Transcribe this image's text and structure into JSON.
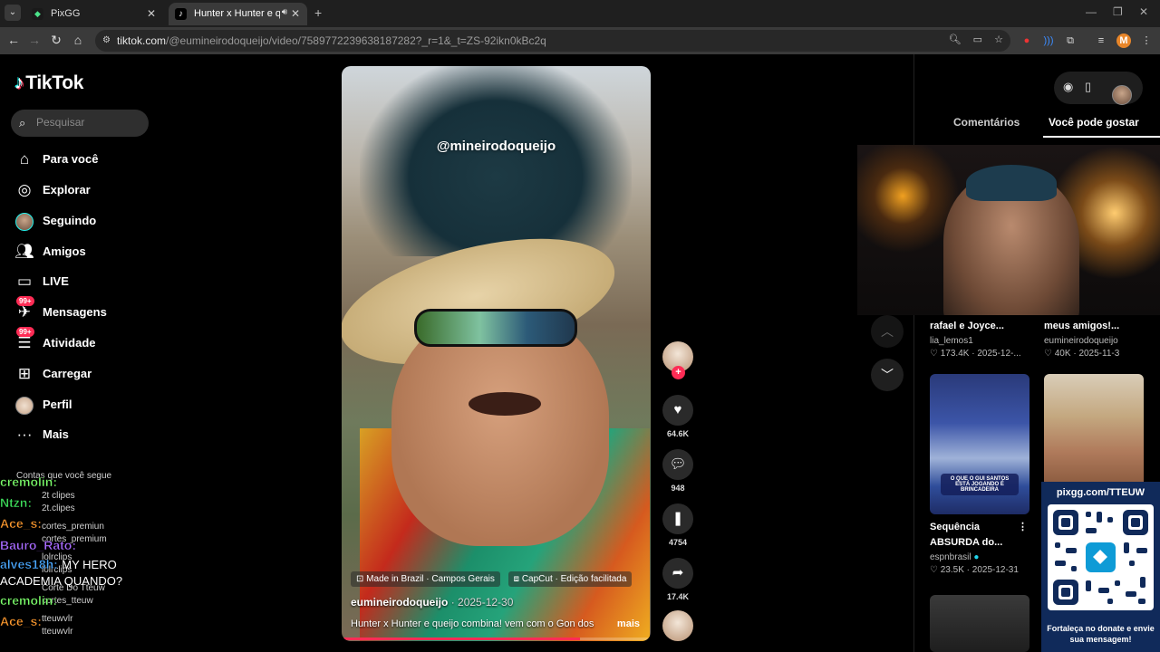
{
  "browser": {
    "tabs": [
      {
        "title": "PixGG",
        "active": false
      },
      {
        "title": "Hunter x Hunter e queijo co",
        "active": true
      }
    ],
    "url_host": "tiktok.com",
    "url_path": "/@eumineirodoqueijo/video/7589772239638187282?_r=1&_t=ZS-92ikn0kBc2q",
    "profile_initial": "M"
  },
  "sidebar": {
    "logo": "TikTok",
    "search_placeholder": "Pesquisar",
    "items": [
      {
        "label": "Para você",
        "icon": "home-icon"
      },
      {
        "label": "Explorar",
        "icon": "compass-icon"
      },
      {
        "label": "Seguindo",
        "icon": "following-avatar-icon"
      },
      {
        "label": "Amigos",
        "icon": "friends-icon"
      },
      {
        "label": "LIVE",
        "icon": "live-icon"
      },
      {
        "label": "Mensagens",
        "icon": "messages-icon",
        "badge": "99+"
      },
      {
        "label": "Atividade",
        "icon": "activity-icon",
        "badge": "99+"
      },
      {
        "label": "Carregar",
        "icon": "upload-icon"
      },
      {
        "label": "Perfil",
        "icon": "profile-avatar-icon"
      },
      {
        "label": "Mais",
        "icon": "more-icon"
      }
    ]
  },
  "chat_overlay": {
    "messages": [
      {
        "user": "cremolin:",
        "color": "#7cff6b",
        "text": ""
      },
      {
        "user": "Ntzn:",
        "color": "#3ee05c",
        "text": ""
      },
      {
        "user": "Ace_s:",
        "color": "#ff9a2e",
        "text": ""
      },
      {
        "user": "Bauro_Rato:",
        "color": "#a86bff",
        "text": ""
      },
      {
        "user": "alves18h:",
        "color": "#4aa8ff",
        "text": "MY HERO ACADEMIA QUANDO?"
      },
      {
        "user": "cremolin:",
        "color": "#7cff6b",
        "text": ""
      },
      {
        "user": "Ace_s:",
        "color": "#ff9a2e",
        "text": ""
      }
    ],
    "ghost_lines": [
      "Contas que você segue",
      "2t clipes",
      "2t.clipes",
      "cortes_premiun",
      "cortes_premium",
      "lolrclips",
      "lolrclips",
      "Corte Do Tteuw",
      "cortes_tteuw",
      "tteuwvlr",
      "tteuwvlr"
    ]
  },
  "video": {
    "watermark": "@mineirodoqueijo",
    "tag1": "Made in Brazil · Campos Gerais",
    "tag2": "CapCut · Edição facilitada",
    "author": "eumineirodoqueijo",
    "date": "· 2025-12-30",
    "caption": "Hunter x Hunter e queijo combina! vem com o Gon dos",
    "more": "mais",
    "progress": 0.77
  },
  "actions": {
    "likes": "64.6K",
    "comments": "948",
    "saves": "4754",
    "shares": "17.4K"
  },
  "right_panel": {
    "tabs": [
      "Comentários",
      "Você pode gostar"
    ],
    "cards": [
      {
        "title": "rafael e Joyce...",
        "user": "lia_lemos1",
        "likes": "173.4K",
        "date": "2025-12-..."
      },
      {
        "title": "meus amigos!...",
        "user": "eumineirodoqueijo",
        "likes": "40K",
        "date": "2025-11-3"
      },
      {
        "title": "Sequência ABSURDA do...",
        "user": "espnbrasil",
        "likes": "23.5K",
        "date": "2025-12-31",
        "thumb_text": "O QUE O GUI SANTOS ESTÁ JOGANDO É BRINCADEIRA"
      },
      {
        "title": "",
        "user": "",
        "likes": "",
        "date": ""
      }
    ]
  },
  "qr_overlay": {
    "url": "pixgg.com/TTEUW",
    "note": "Fortaleça no donate e envie sua mensagem!"
  },
  "colors": {
    "accent": "#fe2c55",
    "cyan": "#25f4ee",
    "bg": "#000000"
  }
}
